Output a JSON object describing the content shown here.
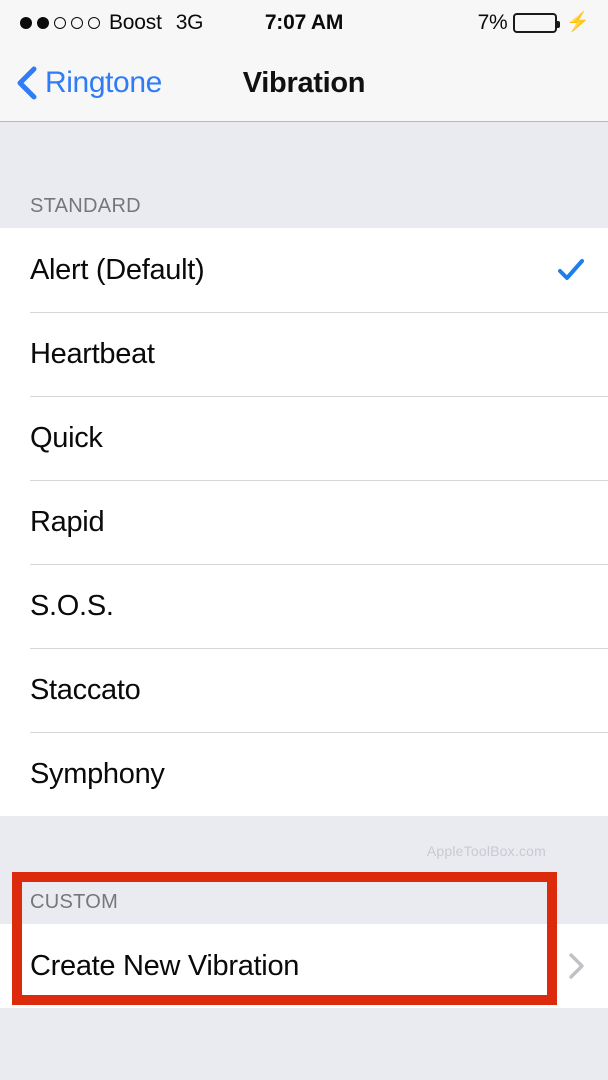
{
  "status_bar": {
    "signal_dots_total": 5,
    "signal_dots_filled": 2,
    "carrier": "Boost",
    "network": "3G",
    "time": "7:07 AM",
    "battery_percent_label": "7%",
    "battery_level": 7,
    "battery_color": "#D93B2B",
    "charging_icon": "⚡",
    "charging": true
  },
  "navbar": {
    "back_label": "Ringtone",
    "back_icon": "chevron-left-icon",
    "title": "Vibration",
    "accent_color": "#2F7CF6"
  },
  "sections": [
    {
      "header": "STANDARD",
      "rows": [
        {
          "label": "Alert (Default)",
          "selected": true
        },
        {
          "label": "Heartbeat",
          "selected": false
        },
        {
          "label": "Quick",
          "selected": false
        },
        {
          "label": "Rapid",
          "selected": false
        },
        {
          "label": "S.O.S.",
          "selected": false
        },
        {
          "label": "Staccato",
          "selected": false
        },
        {
          "label": "Symphony",
          "selected": false
        }
      ]
    },
    {
      "header": "CUSTOM",
      "rows": [
        {
          "label": "Create New Vibration",
          "disclosure": true
        }
      ]
    }
  ],
  "watermark": "AppleToolBox.com",
  "annotation": {
    "type": "highlight-rectangle",
    "color": "#DC2A0C",
    "target": "CUSTOM section with Create New Vibration"
  }
}
